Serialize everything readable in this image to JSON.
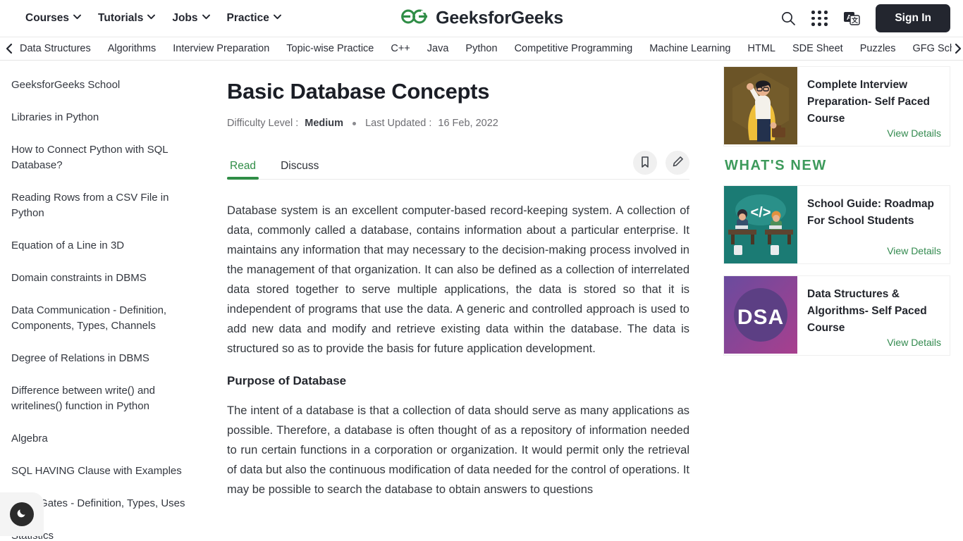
{
  "header": {
    "nav_items": [
      {
        "label": "Courses",
        "icon": "chevron-down-icon"
      },
      {
        "label": "Tutorials",
        "icon": "chevron-down-icon"
      },
      {
        "label": "Jobs",
        "icon": "chevron-down-icon"
      },
      {
        "label": "Practice",
        "icon": "chevron-down-icon"
      }
    ],
    "brand": "GeeksforGeeks",
    "brand_color": "#2f8d46",
    "brand_text_color": "#22272f",
    "icons": [
      "search-icon",
      "apps-grid-icon",
      "translate-icon"
    ],
    "signin_label": "Sign In"
  },
  "subnav": {
    "left_arrow": "chevron-left-icon",
    "right_arrow": "chevron-right-icon",
    "links": [
      "Data Structures",
      "Algorithms",
      "Interview Preparation",
      "Topic-wise Practice",
      "C++",
      "Java",
      "Python",
      "Competitive Programming",
      "Machine Learning",
      "HTML",
      "SDE Sheet",
      "Puzzles",
      "GFG School"
    ]
  },
  "sidebar": {
    "items": [
      "GeeksforGeeks School",
      "Libraries in Python",
      "How to Connect Python with SQL Database?",
      "Reading Rows from a CSV File in Python",
      "Equation of a Line in 3D",
      "Domain constraints in DBMS",
      "Data Communication - Definition, Components, Types, Channels",
      "Degree of Relations in DBMS",
      "Difference between write() and writelines() function in Python",
      "Algebra",
      "SQL HAVING Clause with Examples",
      "Logic Gates - Definition, Types, Uses",
      "Statistics"
    ],
    "theme_toggle_icon": "moon-icon"
  },
  "article": {
    "title": "Basic Database Concepts",
    "difficulty_label": "Difficulty Level :",
    "difficulty_value": "Medium",
    "updated_label": "Last Updated :",
    "updated_value": "16 Feb, 2022",
    "tabs": [
      {
        "label": "Read",
        "active": true
      },
      {
        "label": "Discuss",
        "active": false
      }
    ],
    "active_tab_color": "#2f8d46",
    "actions": [
      {
        "name": "bookmark-button",
        "icon": "bookmark-icon"
      },
      {
        "name": "edit-button",
        "icon": "pencil-icon"
      }
    ],
    "paragraph_1": "Database system is an excellent computer-based record-keeping system. A collection of data, commonly called a database, contains information about a particular enterprise. It maintains any information that may necessary to the decision-making process involved in the management of that organization. It can also be defined as a collection of interrelated data stored together to serve multiple applications, the data is stored so that it is independent of programs that use the data. A generic and controlled approach is used to add new data and modify and retrieve existing data within the database. The data is structured so as to provide the basis for future application development.",
    "heading_2": "Purpose of Database",
    "paragraph_2": "The intent of a database is that a collection of data should serve as many applications as possible. Therefore, a database is often thought of as a repository of information needed to run certain functions in a corporation or organization. It would permit only the retrieval of data but also the continuous modification of data needed for the control of operations. It may be possible to search the database to obtain answers to questions"
  },
  "right_rail": {
    "top_card": {
      "title": "Complete Interview Preparation- Self Paced Course",
      "link_label": "View Details",
      "thumb": "interview-prep-illustration"
    },
    "whats_new_heading": "WHAT'S NEW",
    "cards": [
      {
        "title": "School Guide: Roadmap For School Students",
        "link_label": "View Details",
        "thumb": "school-guide-illustration"
      },
      {
        "title": "Data Structures & Algorithms- Self Paced Course",
        "link_label": "View Details",
        "thumb": "dsa-badge",
        "thumb_text": "DSA"
      }
    ]
  }
}
